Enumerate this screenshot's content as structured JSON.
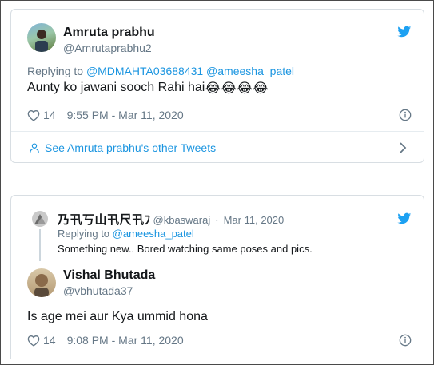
{
  "tweet1": {
    "name": "Amruta prabhu",
    "handle": "@Amrutaprabhu2",
    "replying_prefix": "Replying to",
    "replying_to": "@MDMAHTA03688431 @ameesha_patel",
    "text": "Aunty ko jawani sooch Rahi hai",
    "emojis": "😂😂😂😂",
    "likes": "14",
    "timestamp": "9:55 PM - Mar 11, 2020",
    "other_tweets_link": "See Amruta prabhu's other Tweets"
  },
  "tweet2": {
    "parent": {
      "name": "乃卂丂山卂尺卂ﾌ",
      "handle": "@kbaswaraj",
      "sep": "·",
      "date": "Mar 11, 2020",
      "replying_prefix": "Replying to",
      "replying_to": "@ameesha_patel",
      "text": "Something new.. Bored watching same poses and pics."
    },
    "name": "Vishal Bhutada",
    "handle": "@vbhutada37",
    "text": "Is age mei aur Kya ummid hona",
    "likes": "14",
    "timestamp": "9:08 PM - Mar 11, 2020"
  },
  "colors": {
    "twitter_blue": "#1da1f2",
    "link": "#1b95e0",
    "muted": "#657786",
    "border": "#d8dee3"
  },
  "icons": [
    "twitter-bird-icon",
    "heart-icon",
    "info-icon",
    "user-icon",
    "chevron-right-icon"
  ]
}
